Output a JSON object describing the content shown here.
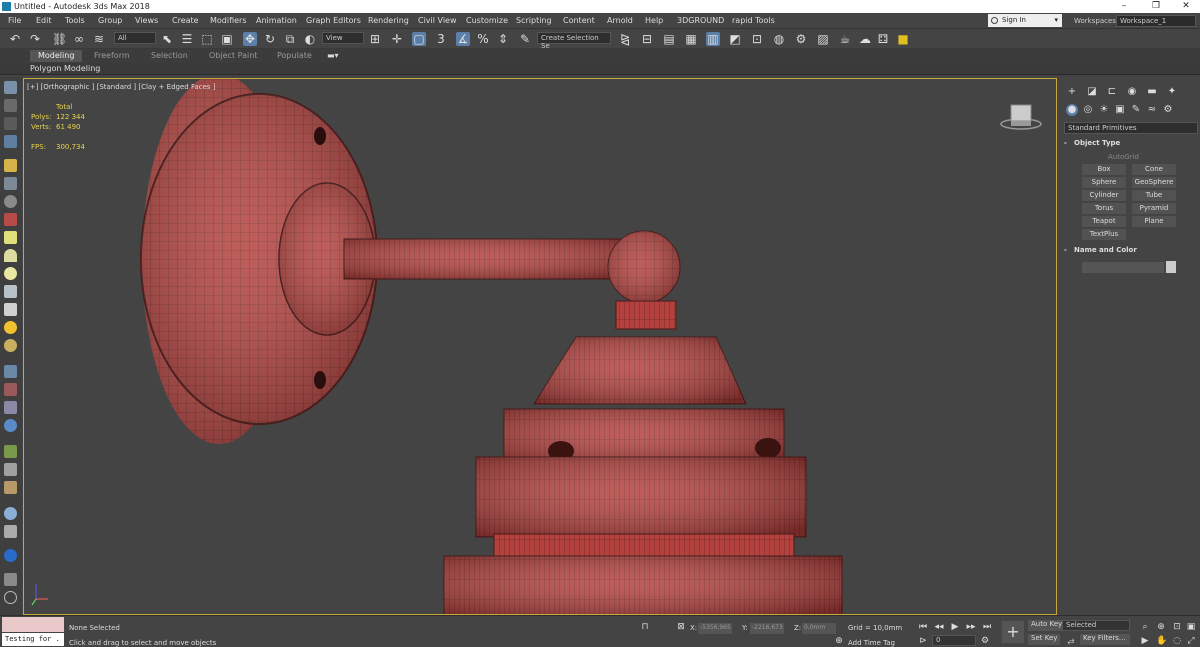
{
  "window": {
    "title": "Untitled - Autodesk 3ds Max 2018",
    "minimize": "–",
    "maximize": "❐",
    "close": "✕"
  },
  "menu": [
    "File",
    "Edit",
    "Tools",
    "Group",
    "Views",
    "Create",
    "Modifiers",
    "Animation",
    "Graph Editors",
    "Rendering",
    "Civil View",
    "Customize",
    "Scripting",
    "Content",
    "Arnold",
    "Help",
    "3DGROUND",
    "rapid Tools"
  ],
  "signin": "Sign In",
  "workspaces": {
    "label": "Workspaces:",
    "value": "Workspace_1"
  },
  "toolbar": {
    "filter_select": "All",
    "ref_coord_select": "View",
    "named_selection": "Create Selection Se"
  },
  "ribbon": {
    "tabs": [
      "Modeling",
      "Freeform",
      "Selection",
      "Object Paint",
      "Populate"
    ],
    "active": "Modeling",
    "sub": "Polygon Modeling"
  },
  "viewport": {
    "label": "[+] [Orthographic ] [Standard ] [Clay + Edged Faces ]",
    "stats": {
      "total_label": "Total",
      "polys_label": "Polys:",
      "polys_value": "122 344",
      "verts_label": "Verts:",
      "verts_value": "61 490",
      "fps_label": "FPS:",
      "fps_value": "300,734"
    }
  },
  "command_panel": {
    "category_select": "Standard Primitives",
    "object_type_title": "Object Type",
    "autogrid": "AutoGrid",
    "buttons": [
      "Box",
      "Cone",
      "Sphere",
      "GeoSphere",
      "Cylinder",
      "Tube",
      "Torus",
      "Pyramid",
      "Teapot",
      "Plane",
      "TextPlus"
    ],
    "name_color_title": "Name and Color",
    "expand_sign": "-"
  },
  "statusbar": {
    "maxscript": "Testing for .",
    "selection": "None Selected",
    "prompt": "Click and drag to select and move objects",
    "x_label": "X:",
    "x_value": "-5356,965",
    "y_label": "Y:",
    "y_value": "-2216,673",
    "z_label": "Z:",
    "z_value": "0,0mm",
    "grid": "Grid = 10,0mm",
    "add_time_tag": "Add Time Tag",
    "frame": "0",
    "auto_key": "Auto Key",
    "set_key": "Set Key",
    "key_mode": "Selected",
    "key_filters": "Key Filters..."
  },
  "colors": {
    "model_red": "#b3413d",
    "viewport_border": "#c8a83a",
    "stats_yellow": "#e5d24a",
    "active_blue": "#5b7fa8"
  }
}
